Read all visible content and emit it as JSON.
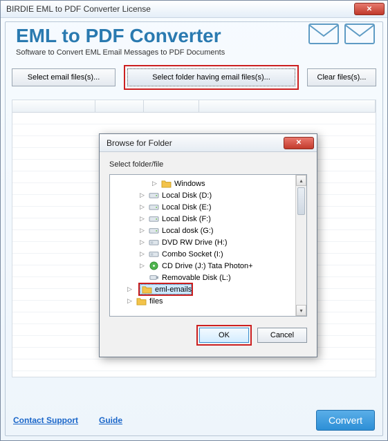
{
  "window_title": "BIRDIE EML to PDF Converter License",
  "header": {
    "title": "EML to PDF Converter",
    "subtitle": "Software to Convert EML Email Messages to PDF Documents"
  },
  "toolbar": {
    "select_files": "Select email files(s)...",
    "select_folder": "Select folder having email files(s)...",
    "clear": "Clear files(s)..."
  },
  "footer": {
    "contact": "Contact Support",
    "guide": "Guide",
    "convert": "Convert"
  },
  "dialog": {
    "title": "Browse for Folder",
    "label": "Select folder/file",
    "ok": "OK",
    "cancel": "Cancel",
    "tree": [
      {
        "indent": 3,
        "expander": "▷",
        "icon": "folder",
        "label": "Windows"
      },
      {
        "indent": 2,
        "expander": "▷",
        "icon": "drive",
        "label": "Local Disk (D:)"
      },
      {
        "indent": 2,
        "expander": "▷",
        "icon": "drive",
        "label": "Local Disk (E:)"
      },
      {
        "indent": 2,
        "expander": "▷",
        "icon": "drive",
        "label": "Local Disk (F:)"
      },
      {
        "indent": 2,
        "expander": "▷",
        "icon": "drive",
        "label": "Local dosk  (G:)"
      },
      {
        "indent": 2,
        "expander": "▷",
        "icon": "dvd",
        "label": "DVD RW Drive (H:)"
      },
      {
        "indent": 2,
        "expander": "▷",
        "icon": "dvd",
        "label": "Combo Socket (I:)"
      },
      {
        "indent": 2,
        "expander": "▷",
        "icon": "cd",
        "label": "CD Drive (J:) Tata Photon+"
      },
      {
        "indent": 2,
        "expander": "",
        "icon": "usb",
        "label": "Removable Disk (L:)"
      },
      {
        "indent": 1,
        "expander": "▷",
        "icon": "folder",
        "label": "eml-emails",
        "selected": true
      },
      {
        "indent": 1,
        "expander": "▷",
        "icon": "folder",
        "label": "files"
      }
    ]
  }
}
